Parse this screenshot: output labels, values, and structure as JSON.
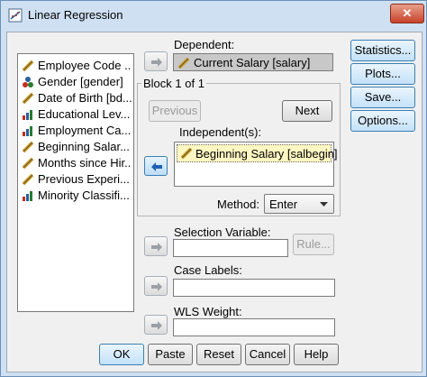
{
  "window": {
    "title": "Linear Regression",
    "close_label": "✕"
  },
  "variables": [
    {
      "label": "Employee Code ...",
      "icon": "scale-icon"
    },
    {
      "label": "Gender [gender]",
      "icon": "nominal-icon"
    },
    {
      "label": "Date of Birth [bd...",
      "icon": "scale-icon"
    },
    {
      "label": "Educational Lev...",
      "icon": "ordinal-icon"
    },
    {
      "label": "Employment Ca...",
      "icon": "ordinal-icon"
    },
    {
      "label": "Beginning Salar...",
      "icon": "scale-icon"
    },
    {
      "label": "Months since Hir...",
      "icon": "scale-icon"
    },
    {
      "label": "Previous Experi...",
      "icon": "scale-icon"
    },
    {
      "label": "Minority Classifi...",
      "icon": "ordinal-icon"
    }
  ],
  "dependent": {
    "label": "Dependent:",
    "value": "Current Salary [salary]"
  },
  "block": {
    "title": "Block 1 of 1",
    "previous_label": "Previous",
    "next_label": "Next",
    "independents_label": "Independent(s):",
    "independents": [
      "Beginning Salary [salbegin]"
    ],
    "method_label": "Method:",
    "method_value": "Enter"
  },
  "selection": {
    "label": "Selection Variable:",
    "value": "",
    "rule_label": "Rule..."
  },
  "case_labels": {
    "label": "Case Labels:",
    "value": ""
  },
  "wls": {
    "label": "WLS Weight:",
    "value": ""
  },
  "side_buttons": {
    "statistics": "Statistics...",
    "plots": "Plots...",
    "save": "Save...",
    "options": "Options..."
  },
  "bottom_buttons": {
    "ok": "OK",
    "paste": "Paste",
    "reset": "Reset",
    "cancel": "Cancel",
    "help": "Help"
  },
  "colors": {
    "accent_border": "#3c7fb1",
    "selected_item": "#fff7c2",
    "close_button": "#c8432a"
  }
}
